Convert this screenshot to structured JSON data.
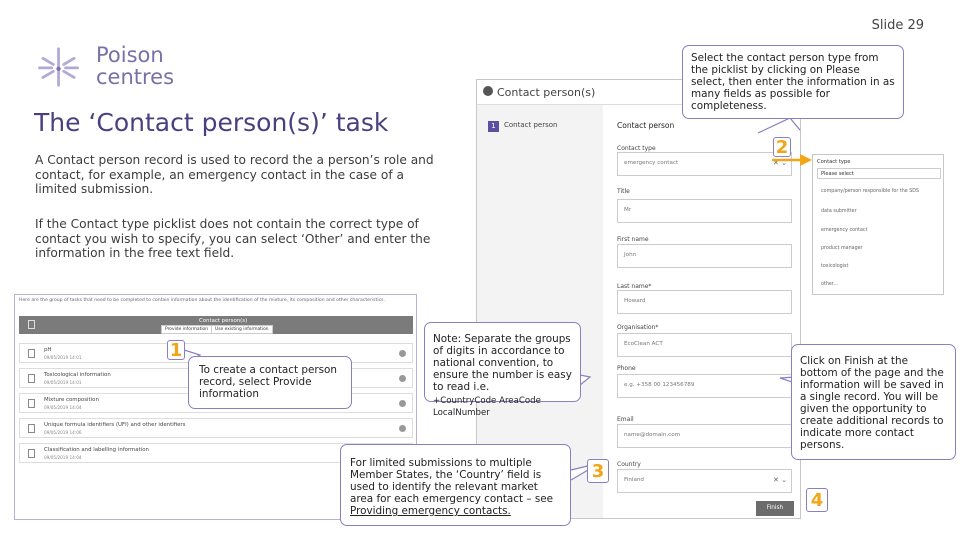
{
  "slide": {
    "number": "Slide 29"
  },
  "logo": {
    "line1": "Poison",
    "line2": "centres"
  },
  "title": "The ‘Contact person(s)’ task",
  "paragraphs": [
    "A Contact person record is used to record the a person’s role and contact, for example, an emergency contact in the case of a limited submission.",
    "If the Contact type picklist does not contain the correct type of contact you wish to specify, you can select ‘Other’ and enter the information in the free text field."
  ],
  "callouts": {
    "top_right": "Select the contact person type from the picklist by clicking on Please select, then enter the information in as many fields as possible for completeness.",
    "provide_info": "To create a contact person record, select Provide information",
    "note": "Note: Separate the groups of digits in accordance to national convention, to ensure the number is easy to read i.e.",
    "note_format": "+CountryCode AreaCode LocalNumber",
    "limited": "For limited submissions to multiple Member States, the ‘Country’ field is used to identify the relevant market area for each emergency contact – see",
    "limited_link": "Providing emergency contacts.",
    "finish": "Click on Finish at the bottom of the page and the information will be saved in a single record. You will be given the opportunity to create additional records to indicate more contact persons."
  },
  "step_numbers": [
    "1",
    "2",
    "3",
    "4"
  ],
  "left_screen": {
    "header_text": "Here are the group of tasks that need to be completed to contain information about the identification of the mixture, its composition and other characteristics.",
    "active_task": "Contact person(s)",
    "buttons": [
      "Provide information",
      "Use existing information"
    ],
    "tasks": [
      {
        "name": "pH",
        "date": "09/05/2019 14:01"
      },
      {
        "name": "Toxicological information",
        "date": "09/05/2019 14:01"
      },
      {
        "name": "Mixture composition",
        "date": "09/05/2019 14:04"
      },
      {
        "name": "Unique formula identifiers (UFI) and other identifiers",
        "date": "09/05/2019 14:06"
      },
      {
        "name": "Classification and labelling information",
        "date": "09/05/2019 14:04"
      }
    ]
  },
  "right_screen": {
    "window_title": "Contact person(s)",
    "side_badge": "1",
    "side_label": "Contact person",
    "section": "Contact person",
    "fields": [
      {
        "label": "Contact type",
        "value": "emergency contact"
      },
      {
        "label": "Title",
        "value": "Mr"
      },
      {
        "label": "First name",
        "value": "John"
      },
      {
        "label": "Last name*",
        "value": "Howard"
      },
      {
        "label": "Organisation*",
        "value": "EcoClean ACT"
      },
      {
        "label": "Phone",
        "value": "e.g. +358 00 123456789"
      },
      {
        "label": "Email",
        "value": "name@domain.com"
      },
      {
        "label": "Country",
        "value": "Finland"
      }
    ],
    "finish_label": "Finish"
  },
  "picklist": {
    "label": "Contact type",
    "selected": "Please select",
    "options": [
      "company/person responsible for the SDS",
      "data submitter",
      "emergency contact",
      "product manager",
      "toxicologist",
      "other..."
    ]
  },
  "colors": {
    "accent": "#5b4fa0",
    "callout_border": "#8b7fc0",
    "step_number": "#f2a516"
  }
}
